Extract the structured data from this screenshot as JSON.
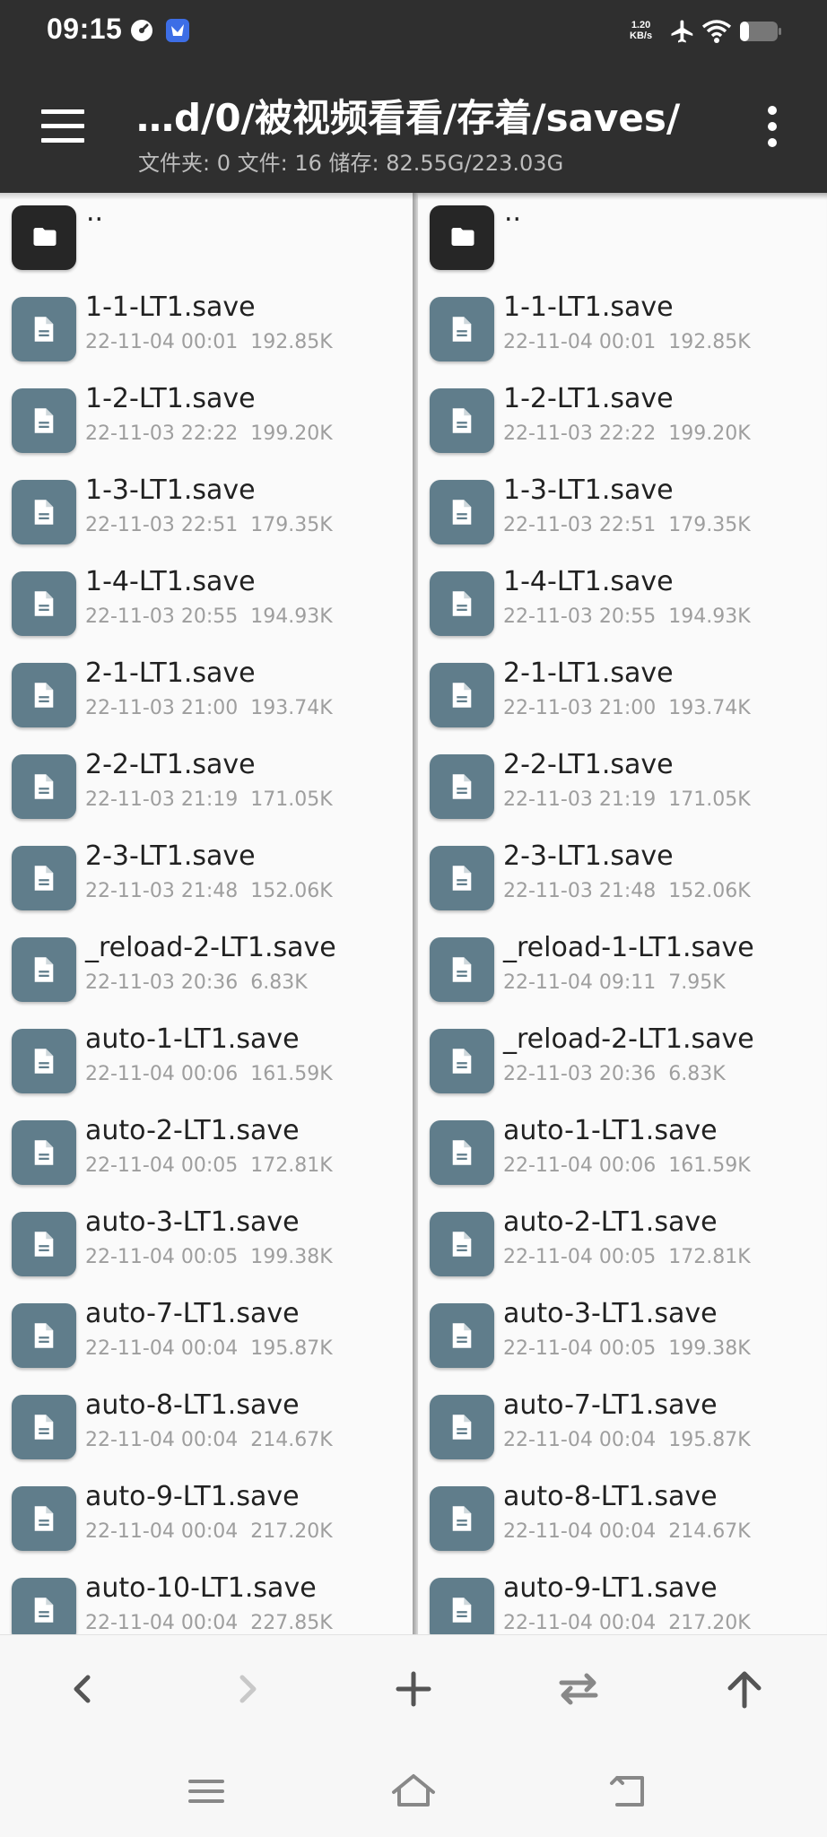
{
  "status_bar": {
    "time": "09:15",
    "net_speed_value": "1.20",
    "net_speed_unit": "KB/s",
    "icons": [
      "speed-dial-icon",
      "app-notification-icon",
      "airplane-icon",
      "wifi-icon",
      "battery-icon"
    ]
  },
  "appbar": {
    "path": "…d/0/被视频看看/存着/saves/",
    "summary": "文件夹: 0  文件: 16  储存: 82.55G/223.03G"
  },
  "up_item": "..",
  "left_pane": {
    "files": [
      {
        "name": "1-1-LT1.save",
        "date": "22-11-04 00:01",
        "size": "192.85K"
      },
      {
        "name": "1-2-LT1.save",
        "date": "22-11-03 22:22",
        "size": "199.20K"
      },
      {
        "name": "1-3-LT1.save",
        "date": "22-11-03 22:51",
        "size": "179.35K"
      },
      {
        "name": "1-4-LT1.save",
        "date": "22-11-03 20:55",
        "size": "194.93K"
      },
      {
        "name": "2-1-LT1.save",
        "date": "22-11-03 21:00",
        "size": "193.74K"
      },
      {
        "name": "2-2-LT1.save",
        "date": "22-11-03 21:19",
        "size": "171.05K"
      },
      {
        "name": "2-3-LT1.save",
        "date": "22-11-03 21:48",
        "size": "152.06K"
      },
      {
        "name": "_reload-2-LT1.save",
        "date": "22-11-03 20:36",
        "size": "6.83K"
      },
      {
        "name": "auto-1-LT1.save",
        "date": "22-11-04 00:06",
        "size": "161.59K"
      },
      {
        "name": "auto-2-LT1.save",
        "date": "22-11-04 00:05",
        "size": "172.81K"
      },
      {
        "name": "auto-3-LT1.save",
        "date": "22-11-04 00:05",
        "size": "199.38K"
      },
      {
        "name": "auto-7-LT1.save",
        "date": "22-11-04 00:04",
        "size": "195.87K"
      },
      {
        "name": "auto-8-LT1.save",
        "date": "22-11-04 00:04",
        "size": "214.67K"
      },
      {
        "name": "auto-9-LT1.save",
        "date": "22-11-04 00:04",
        "size": "217.20K"
      },
      {
        "name": "auto-10-LT1.save",
        "date": "22-11-04 00:04",
        "size": "227.85K"
      }
    ]
  },
  "right_pane": {
    "files": [
      {
        "name": "1-1-LT1.save",
        "date": "22-11-04 00:01",
        "size": "192.85K"
      },
      {
        "name": "1-2-LT1.save",
        "date": "22-11-03 22:22",
        "size": "199.20K"
      },
      {
        "name": "1-3-LT1.save",
        "date": "22-11-03 22:51",
        "size": "179.35K"
      },
      {
        "name": "1-4-LT1.save",
        "date": "22-11-03 20:55",
        "size": "194.93K"
      },
      {
        "name": "2-1-LT1.save",
        "date": "22-11-03 21:00",
        "size": "193.74K"
      },
      {
        "name": "2-2-LT1.save",
        "date": "22-11-03 21:19",
        "size": "171.05K"
      },
      {
        "name": "2-3-LT1.save",
        "date": "22-11-03 21:48",
        "size": "152.06K"
      },
      {
        "name": "_reload-1-LT1.save",
        "date": "22-11-04 09:11",
        "size": "7.95K"
      },
      {
        "name": "_reload-2-LT1.save",
        "date": "22-11-03 20:36",
        "size": "6.83K"
      },
      {
        "name": "auto-1-LT1.save",
        "date": "22-11-04 00:06",
        "size": "161.59K"
      },
      {
        "name": "auto-2-LT1.save",
        "date": "22-11-04 00:05",
        "size": "172.81K"
      },
      {
        "name": "auto-3-LT1.save",
        "date": "22-11-04 00:05",
        "size": "199.38K"
      },
      {
        "name": "auto-7-LT1.save",
        "date": "22-11-04 00:04",
        "size": "195.87K"
      },
      {
        "name": "auto-8-LT1.save",
        "date": "22-11-04 00:04",
        "size": "214.67K"
      },
      {
        "name": "auto-9-LT1.save",
        "date": "22-11-04 00:04",
        "size": "217.20K"
      }
    ]
  },
  "toolbar": {
    "buttons": [
      "back-icon",
      "forward-icon",
      "add-icon",
      "swap-icon",
      "up-icon"
    ]
  },
  "navbar": {
    "buttons": [
      "recents-icon",
      "home-icon",
      "back-nav-icon"
    ]
  },
  "colors": {
    "bar_bg": "#2f2f2f",
    "file_icon": "#607d8b",
    "folder_icon": "#262626",
    "list_bg": "#fafafa"
  }
}
